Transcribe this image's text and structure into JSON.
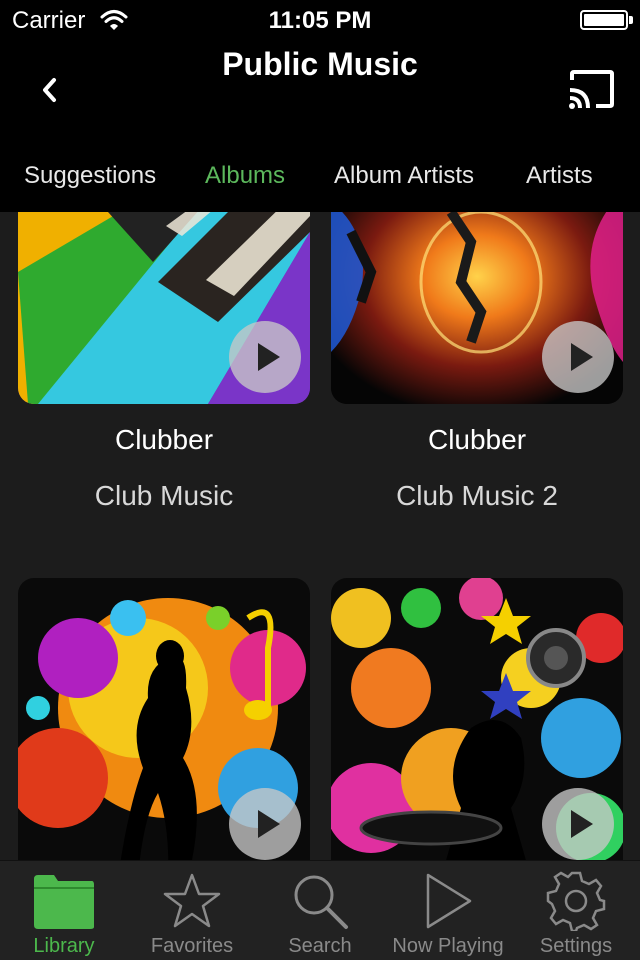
{
  "status_bar": {
    "carrier": "Carrier",
    "time": "11:05 PM"
  },
  "nav": {
    "title": "Public Music"
  },
  "tabs": [
    {
      "label": "Suggestions",
      "active": false
    },
    {
      "label": "Albums",
      "active": true
    },
    {
      "label": "Album Artists",
      "active": false
    },
    {
      "label": "Artists",
      "active": false
    }
  ],
  "albums": [
    {
      "artist": "Clubber",
      "title": "Club Music"
    },
    {
      "artist": "Clubber",
      "title": "Club Music 2"
    },
    {
      "artist": "",
      "title": ""
    },
    {
      "artist": "",
      "title": ""
    }
  ],
  "tab_bar": [
    {
      "label": "Library",
      "icon": "folder-icon",
      "active": true
    },
    {
      "label": "Favorites",
      "icon": "star-icon",
      "active": false
    },
    {
      "label": "Search",
      "icon": "search-icon",
      "active": false
    },
    {
      "label": "Now Playing",
      "icon": "play-icon",
      "active": false
    },
    {
      "label": "Settings",
      "icon": "gear-icon",
      "active": false
    }
  ],
  "colors": {
    "accent": "#5cb85c",
    "background": "#1c1c1c",
    "bar": "#000000"
  }
}
